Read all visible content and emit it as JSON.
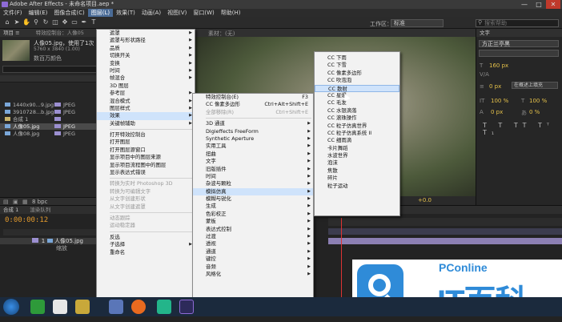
{
  "app": {
    "title": "Adobe After Effects - 未命名项目.aep *",
    "window_controls": [
      "—",
      "□",
      "✕"
    ]
  },
  "menubar": [
    "文件(F)",
    "编辑(E)",
    "图像合成(C)",
    "图层(L)",
    "效果(T)",
    "动画(A)",
    "视图(V)",
    "窗口(W)",
    "帮助(H)"
  ],
  "toolbar": {
    "workspace_label": "工作区：",
    "workspace_value": "标准",
    "search_placeholder": "搜索帮助"
  },
  "project_panel": {
    "tab": "项目 ≡",
    "effects_tab": "特效控制台：人像05",
    "item_name": "人像05.jpg",
    "item_used": "，使用了1次",
    "item_size": "5760 x 3840 (1.00)",
    "item_desc": "数百万颜色",
    "files": [
      {
        "name": "1440x90...9.jpg",
        "type": "JPEG"
      },
      {
        "name": "3910728...b.jpg",
        "type": "JPEG"
      },
      {
        "name": "合成 1",
        "type": ""
      },
      {
        "name": "人像05.jpg",
        "type": "JPEG"
      },
      {
        "name": "人像08.jpg",
        "type": "JPEG"
      }
    ],
    "bpc": "8 bpc"
  },
  "viewer": {
    "label": "素材：(无)",
    "zoom_value": "+0.0"
  },
  "text_panel": {
    "tab": "文字",
    "font": "方正兰亭黑",
    "size": "160 px",
    "tracking": "0 px",
    "align_label": "在概述上填充",
    "scale_v": "100 %",
    "scale_h": "100 %",
    "baseline": "0 px",
    "tsume": "0 %"
  },
  "timeline": {
    "tab": "合成 1",
    "render_tab": "渲染队列",
    "time": "0:00:00:12",
    "layer_name": "人像05.jpg",
    "sub_item": "缩放"
  },
  "layer_menu": [
    {
      "label": "遮罩",
      "arrow": true
    },
    {
      "label": "遮罩与形状路径",
      "arrow": true
    },
    {
      "label": "品质",
      "arrow": true
    },
    {
      "label": "切换开关",
      "arrow": true
    },
    {
      "label": "变换",
      "arrow": true
    },
    {
      "label": "时间",
      "arrow": true
    },
    {
      "label": "帧混合",
      "arrow": true
    },
    {
      "label": "3D 图层",
      "arrow": false
    },
    {
      "label": "参考层",
      "arrow": true
    },
    {
      "label": "混合模式",
      "arrow": true
    },
    {
      "label": "图层样式",
      "arrow": true
    },
    {
      "label": "效果",
      "arrow": true,
      "highlight": true
    },
    {
      "label": "关键帧辅助",
      "arrow": true
    },
    {
      "sep": true
    },
    {
      "label": "打开特效控制台"
    },
    {
      "label": "打开图层"
    },
    {
      "label": "打开图层源窗口"
    },
    {
      "label": "显示项目中的图层来源"
    },
    {
      "label": "显示项目流程图中的图层"
    },
    {
      "label": "显示表达式错误"
    },
    {
      "sep": true
    },
    {
      "label": "转换为实时 Photoshop 3D",
      "disabled": true
    },
    {
      "label": "转换为可编辑文字",
      "disabled": true
    },
    {
      "label": "从文字创建形状",
      "disabled": true
    },
    {
      "label": "从文字创建遮罩",
      "disabled": true
    },
    {
      "sep": true
    },
    {
      "label": "动态跟踪",
      "disabled": true
    },
    {
      "label": "运动稳定器",
      "disabled": true
    },
    {
      "sep": true
    },
    {
      "label": "反选"
    },
    {
      "label": "子选择",
      "arrow": true
    },
    {
      "label": "重命名"
    }
  ],
  "effects_menu": [
    {
      "label": "特效控制台(E)",
      "shortcut": "F3"
    },
    {
      "label": "CC 像素多边形",
      "shortcut": "Ctrl+Alt+Shift+E"
    },
    {
      "label": "全部移除(R)",
      "shortcut": "Ctrl+Shift+E",
      "disabled": true
    },
    {
      "sep": true
    },
    {
      "label": "3D 通道",
      "arrow": true
    },
    {
      "label": "Digieffects FreeForm",
      "arrow": true
    },
    {
      "label": "Synthetic Aperture",
      "arrow": true
    },
    {
      "label": "实用工具",
      "arrow": true
    },
    {
      "label": "扭曲",
      "arrow": true
    },
    {
      "label": "文字",
      "arrow": true
    },
    {
      "label": "旧版插件",
      "arrow": true
    },
    {
      "label": "时间",
      "arrow": true
    },
    {
      "label": "杂波与颗粒",
      "arrow": true
    },
    {
      "label": "模拟仿真",
      "arrow": true,
      "highlight": true
    },
    {
      "label": "模糊与锐化",
      "arrow": true
    },
    {
      "label": "生成",
      "arrow": true
    },
    {
      "label": "色彩校正",
      "arrow": true
    },
    {
      "label": "蒙板",
      "arrow": true
    },
    {
      "label": "表达式控制",
      "arrow": true
    },
    {
      "label": "过渡",
      "arrow": true
    },
    {
      "label": "透视",
      "arrow": true
    },
    {
      "label": "通道",
      "arrow": true
    },
    {
      "label": "键控",
      "arrow": true
    },
    {
      "label": "音频",
      "arrow": true
    },
    {
      "label": "风格化",
      "arrow": true
    }
  ],
  "simulation_menu": [
    {
      "label": "CC 下雨"
    },
    {
      "label": "CC 下雪"
    },
    {
      "label": "CC 像素多边形"
    },
    {
      "label": "CC 吹泡泡"
    },
    {
      "label": "CC 散射",
      "highlight": true
    },
    {
      "label": "CC 星爆"
    },
    {
      "label": "CC 毛发"
    },
    {
      "label": "CC 水银滴落"
    },
    {
      "label": "CC 滚珠操作"
    },
    {
      "label": "CC 粒子仿真世界"
    },
    {
      "label": "CC 粒子仿真系统 II"
    },
    {
      "label": "CC 细雨滴"
    },
    {
      "label": "卡片舞蹈"
    },
    {
      "label": "水波世界"
    },
    {
      "label": "泡沫"
    },
    {
      "label": "焦散"
    },
    {
      "label": "碎片"
    },
    {
      "label": "粒子运动"
    }
  ],
  "watermark": {
    "brand": "PConline",
    "name": "IT百科"
  }
}
